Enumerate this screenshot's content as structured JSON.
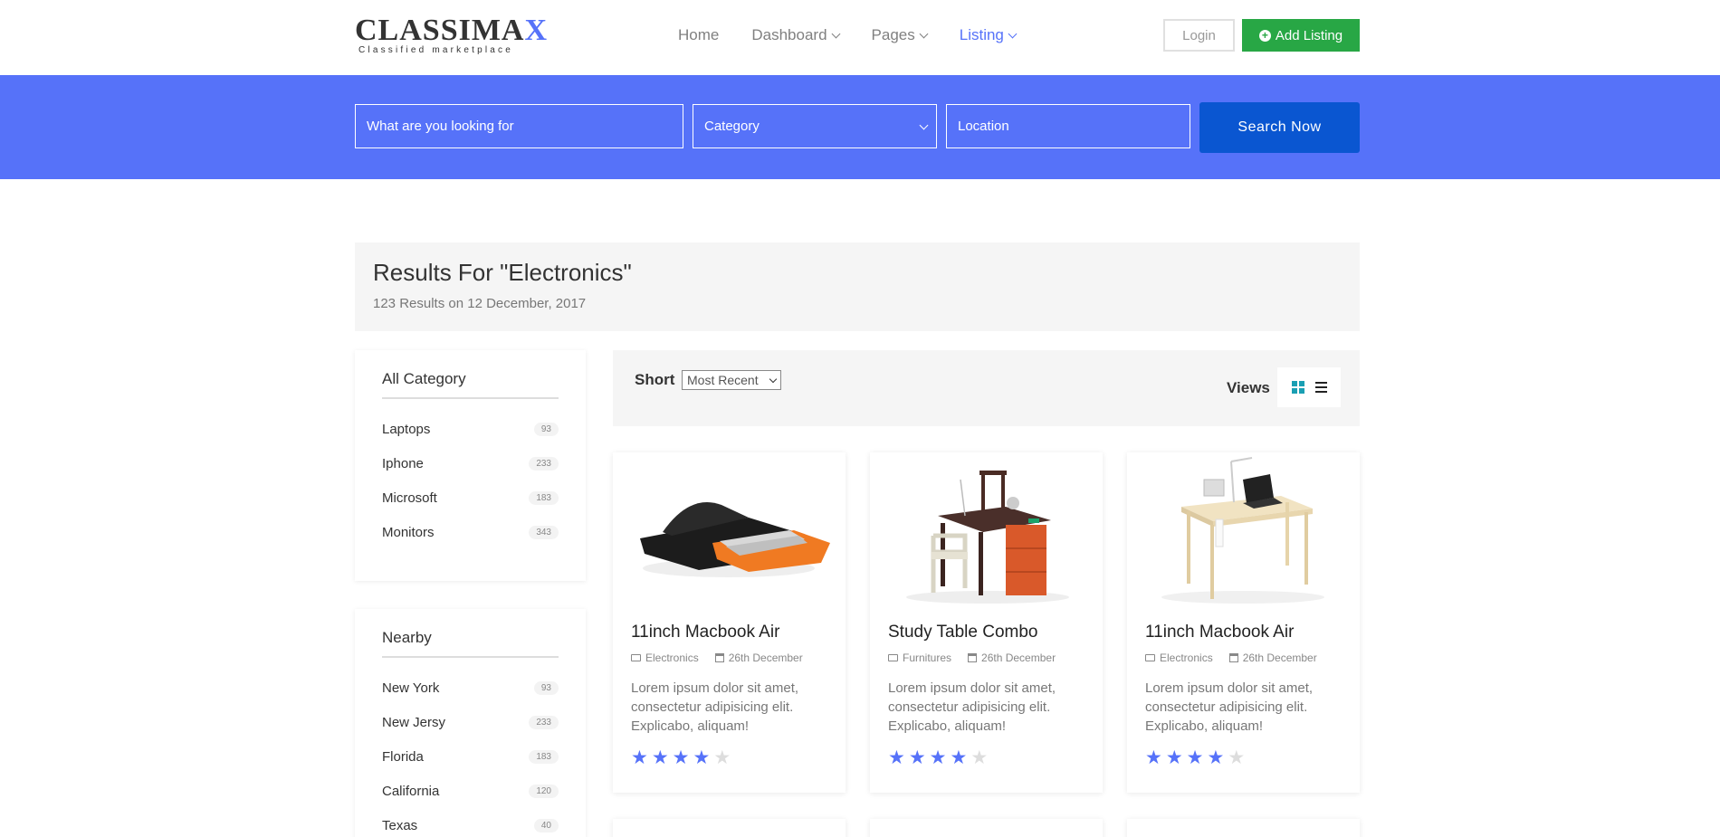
{
  "brand": {
    "name_main": "CLASSIMA",
    "name_accent": "X",
    "tagline": "Classified marketplace",
    "accent_color": "#5672f9"
  },
  "nav": {
    "items": [
      {
        "label": "Home",
        "dropdown": false,
        "active": false
      },
      {
        "label": "Dashboard",
        "dropdown": true,
        "active": false
      },
      {
        "label": "Pages",
        "dropdown": true,
        "active": false
      },
      {
        "label": "Listing",
        "dropdown": true,
        "active": true
      }
    ],
    "login_label": "Login",
    "add_listing_label": "Add Listing",
    "add_listing_color": "#28a745"
  },
  "search": {
    "keyword_placeholder": "What are you looking for",
    "category_value": "Category",
    "location_placeholder": "Location",
    "button_label": "Search Now",
    "band_color": "#5672f9",
    "button_color": "#0a56d1"
  },
  "results": {
    "title": "Results For \"Electronics\"",
    "subtitle": "123 Results on 12 December, 2017"
  },
  "sidebar": {
    "categories": {
      "title": "All Category",
      "items": [
        {
          "label": "Laptops",
          "count": "93"
        },
        {
          "label": "Iphone",
          "count": "233"
        },
        {
          "label": "Microsoft",
          "count": "183"
        },
        {
          "label": "Monitors",
          "count": "343"
        }
      ]
    },
    "nearby": {
      "title": "Nearby",
      "items": [
        {
          "label": "New York",
          "count": "93"
        },
        {
          "label": "New Jersy",
          "count": "233"
        },
        {
          "label": "Florida",
          "count": "183"
        },
        {
          "label": "California",
          "count": "120"
        },
        {
          "label": "Texas",
          "count": "40"
        }
      ]
    }
  },
  "toolbar": {
    "sort_label": "Short",
    "sort_value": "Most Recent",
    "views_label": "Views",
    "grid_icon": "grid-view-icon",
    "list_icon": "list-view-icon"
  },
  "listings": [
    {
      "title": "11inch Macbook Air",
      "category": "Electronics",
      "date": "26th December",
      "description": "Lorem ipsum dolor sit amet, consectetur adipisicing elit. Explicabo, aliquam!",
      "rating": 4,
      "image": "laptop-bag"
    },
    {
      "title": "Study Table Combo",
      "category": "Furnitures",
      "date": "26th December",
      "description": "Lorem ipsum dolor sit amet, consectetur adipisicing elit. Explicabo, aliquam!",
      "rating": 4,
      "image": "study-table"
    },
    {
      "title": "11inch Macbook Air",
      "category": "Electronics",
      "date": "26th December",
      "description": "Lorem ipsum dolor sit amet, consectetur adipisicing elit. Explicabo, aliquam!",
      "rating": 4,
      "image": "desk-laptop"
    }
  ]
}
